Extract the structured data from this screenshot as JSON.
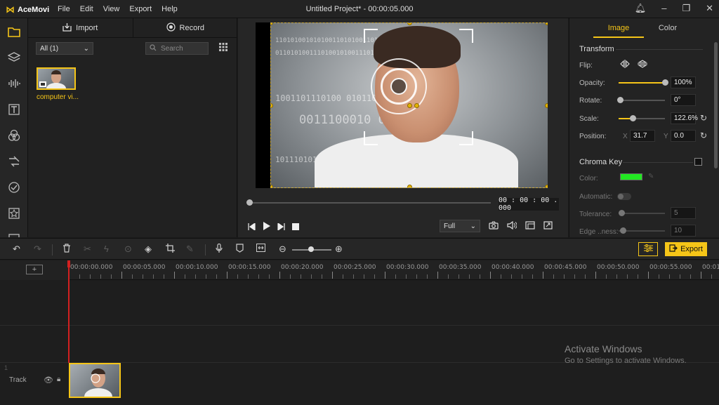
{
  "app": {
    "logo_text": "AceMovi",
    "window_title": "Untitled Project* - 00:00:05.000",
    "menu": [
      "File",
      "Edit",
      "View",
      "Export",
      "Help"
    ]
  },
  "media_panel": {
    "import_label": "Import",
    "record_label": "Record",
    "folder_select": "All (1)",
    "search_placeholder": "Search",
    "item_label": "computer vi..."
  },
  "preview": {
    "timecode": "00 : 00 : 00 . 000",
    "quality": "Full",
    "playhead_fraction": 0.0
  },
  "properties": {
    "tabs": [
      "Image",
      "Color"
    ],
    "transform_title": "Transform",
    "flip_label": "Flip:",
    "opacity_label": "Opacity:",
    "opacity_value": "100%",
    "opacity_fraction": 1.0,
    "rotate_label": "Rotate:",
    "rotate_value": "0°",
    "scale_label": "Scale:",
    "scale_value": "122.6%",
    "position_label": "Position:",
    "position_x_label": "X",
    "position_x": "31.7",
    "position_y_label": "Y",
    "position_y": "0.0",
    "chroma_title": "Chroma Key",
    "color_label": "Color:",
    "chroma_color": "#22e822",
    "automatic_label": "Automatic:",
    "tolerance_label": "Tolerance:",
    "tolerance_value": "5",
    "edge_label": "Edge ..ness:",
    "edge_value": "10"
  },
  "toolbar": {
    "export_label": "Export"
  },
  "timeline": {
    "ticks": [
      "00:00:00.000",
      "00:00:05.000",
      "00:00:10.000",
      "00:00:15.000",
      "00:00:20.000",
      "00:00:25.000",
      "00:00:30.000",
      "00:00:35.000",
      "00:00:40.000",
      "00:00:45.000",
      "00:00:50.000",
      "00:00:55.000",
      "00:01"
    ],
    "track_number": "1",
    "track_label": "Track"
  },
  "watermark": {
    "line1": "Activate Windows",
    "line2": "Go to Settings to activate Windows."
  },
  "colors": {
    "accent": "#f5c518",
    "playhead": "#d42020"
  }
}
